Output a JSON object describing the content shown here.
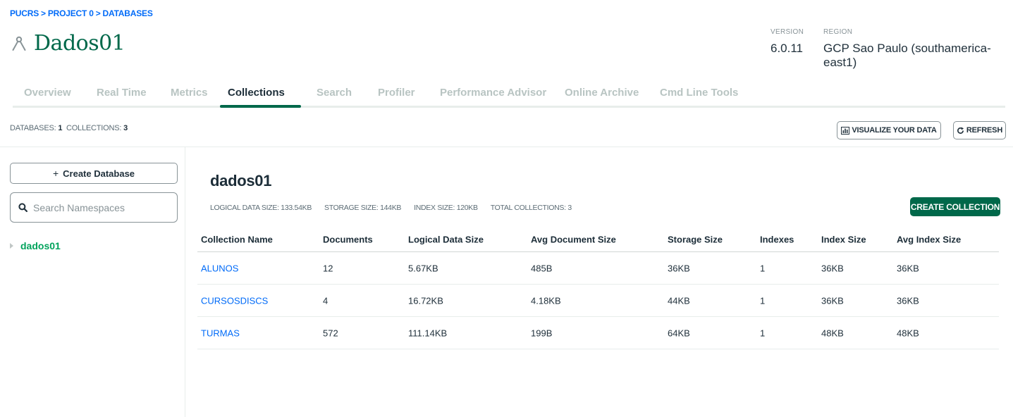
{
  "breadcrumb": [
    "PUCRS",
    "PROJECT 0",
    "DATABASES"
  ],
  "breadcrumb_separator": ">",
  "cluster": {
    "name": "Dados01",
    "version_label": "VERSION",
    "version": "6.0.11",
    "region_label": "REGION",
    "region": "GCP Sao Paulo (southamerica-east1)"
  },
  "tabs": [
    {
      "label": "Overview",
      "active": false
    },
    {
      "label": "Real Time",
      "active": false
    },
    {
      "label": "Metrics",
      "active": false
    },
    {
      "label": "Collections",
      "active": true
    },
    {
      "label": "Search",
      "active": false
    },
    {
      "label": "Profiler",
      "active": false
    },
    {
      "label": "Performance Advisor",
      "active": false
    },
    {
      "label": "Online Archive",
      "active": false
    },
    {
      "label": "Cmd Line Tools",
      "active": false
    }
  ],
  "summary": {
    "databases_label": "DATABASES:",
    "databases": "1",
    "collections_label": "COLLECTIONS:",
    "collections": "3"
  },
  "toolbar": {
    "visualize_label": "VISUALIZE YOUR DATA",
    "refresh_label": "REFRESH"
  },
  "sidebar": {
    "create_db_label": "Create Database",
    "search_placeholder": "Search Namespaces",
    "databases": [
      "dados01"
    ]
  },
  "database": {
    "name": "dados01",
    "stats": [
      "LOGICAL DATA SIZE: 133.54KB",
      "STORAGE SIZE: 144KB",
      "INDEX SIZE: 120KB",
      "TOTAL COLLECTIONS: 3"
    ],
    "create_collection_label": "CREATE COLLECTION"
  },
  "table": {
    "columns": [
      "Collection Name",
      "Documents",
      "Logical Data Size",
      "Avg Document Size",
      "Storage Size",
      "Indexes",
      "Index Size",
      "Avg Index Size"
    ],
    "rows": [
      [
        "ALUNOS",
        "12",
        "5.67KB",
        "485B",
        "36KB",
        "1",
        "36KB",
        "36KB"
      ],
      [
        "CURSOSDISCS",
        "4",
        "16.72KB",
        "4.18KB",
        "44KB",
        "1",
        "36KB",
        "36KB"
      ],
      [
        "TURMAS",
        "572",
        "111.14KB",
        "199B",
        "64KB",
        "1",
        "48KB",
        "48KB"
      ]
    ]
  },
  "colors": {
    "brand_green": "#00684a",
    "link_blue": "#016bf8",
    "tree_green": "#00a35c"
  }
}
